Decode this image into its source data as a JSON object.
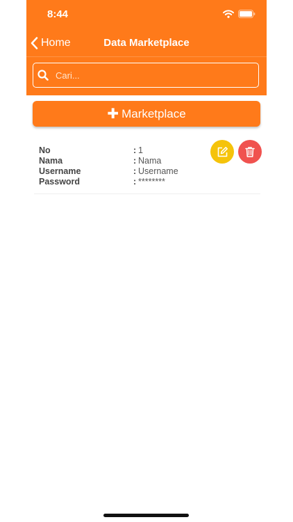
{
  "status": {
    "time": "8:44"
  },
  "nav": {
    "back_label": "Home",
    "title": "Data Marketplace"
  },
  "search": {
    "placeholder": "Cari..."
  },
  "add_button": {
    "label": "Marketplace"
  },
  "items": [
    {
      "fields": [
        {
          "label": "No",
          "value": "1"
        },
        {
          "label": "Nama",
          "value": "Nama"
        },
        {
          "label": "Username",
          "value": "Username"
        },
        {
          "label": "Password",
          "value": "********"
        }
      ]
    }
  ],
  "colors": {
    "primary": "#ff7a1a",
    "edit": "#f5c30a",
    "delete": "#f0524f"
  }
}
